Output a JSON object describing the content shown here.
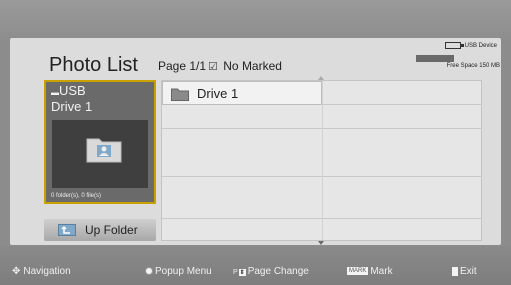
{
  "header": {
    "title": "Photo List",
    "page": "Page 1/1",
    "mark_status": "No Marked",
    "usb_label": "USB Device",
    "free_space": "Free Space 150 MB"
  },
  "left_panel": {
    "drive_line1": "USB",
    "drive_line2": "Drive 1",
    "counts": "0 folder(s), 0 file(s)",
    "up_button": "Up Folder"
  },
  "files": [
    {
      "name": "Drive 1",
      "icon": "folder-icon"
    }
  ],
  "footer": {
    "navigation": "Navigation",
    "popup": "Popup Menu",
    "page_change": "Page Change",
    "mark": "Mark",
    "mark_badge": "MARK",
    "exit": "Exit"
  }
}
